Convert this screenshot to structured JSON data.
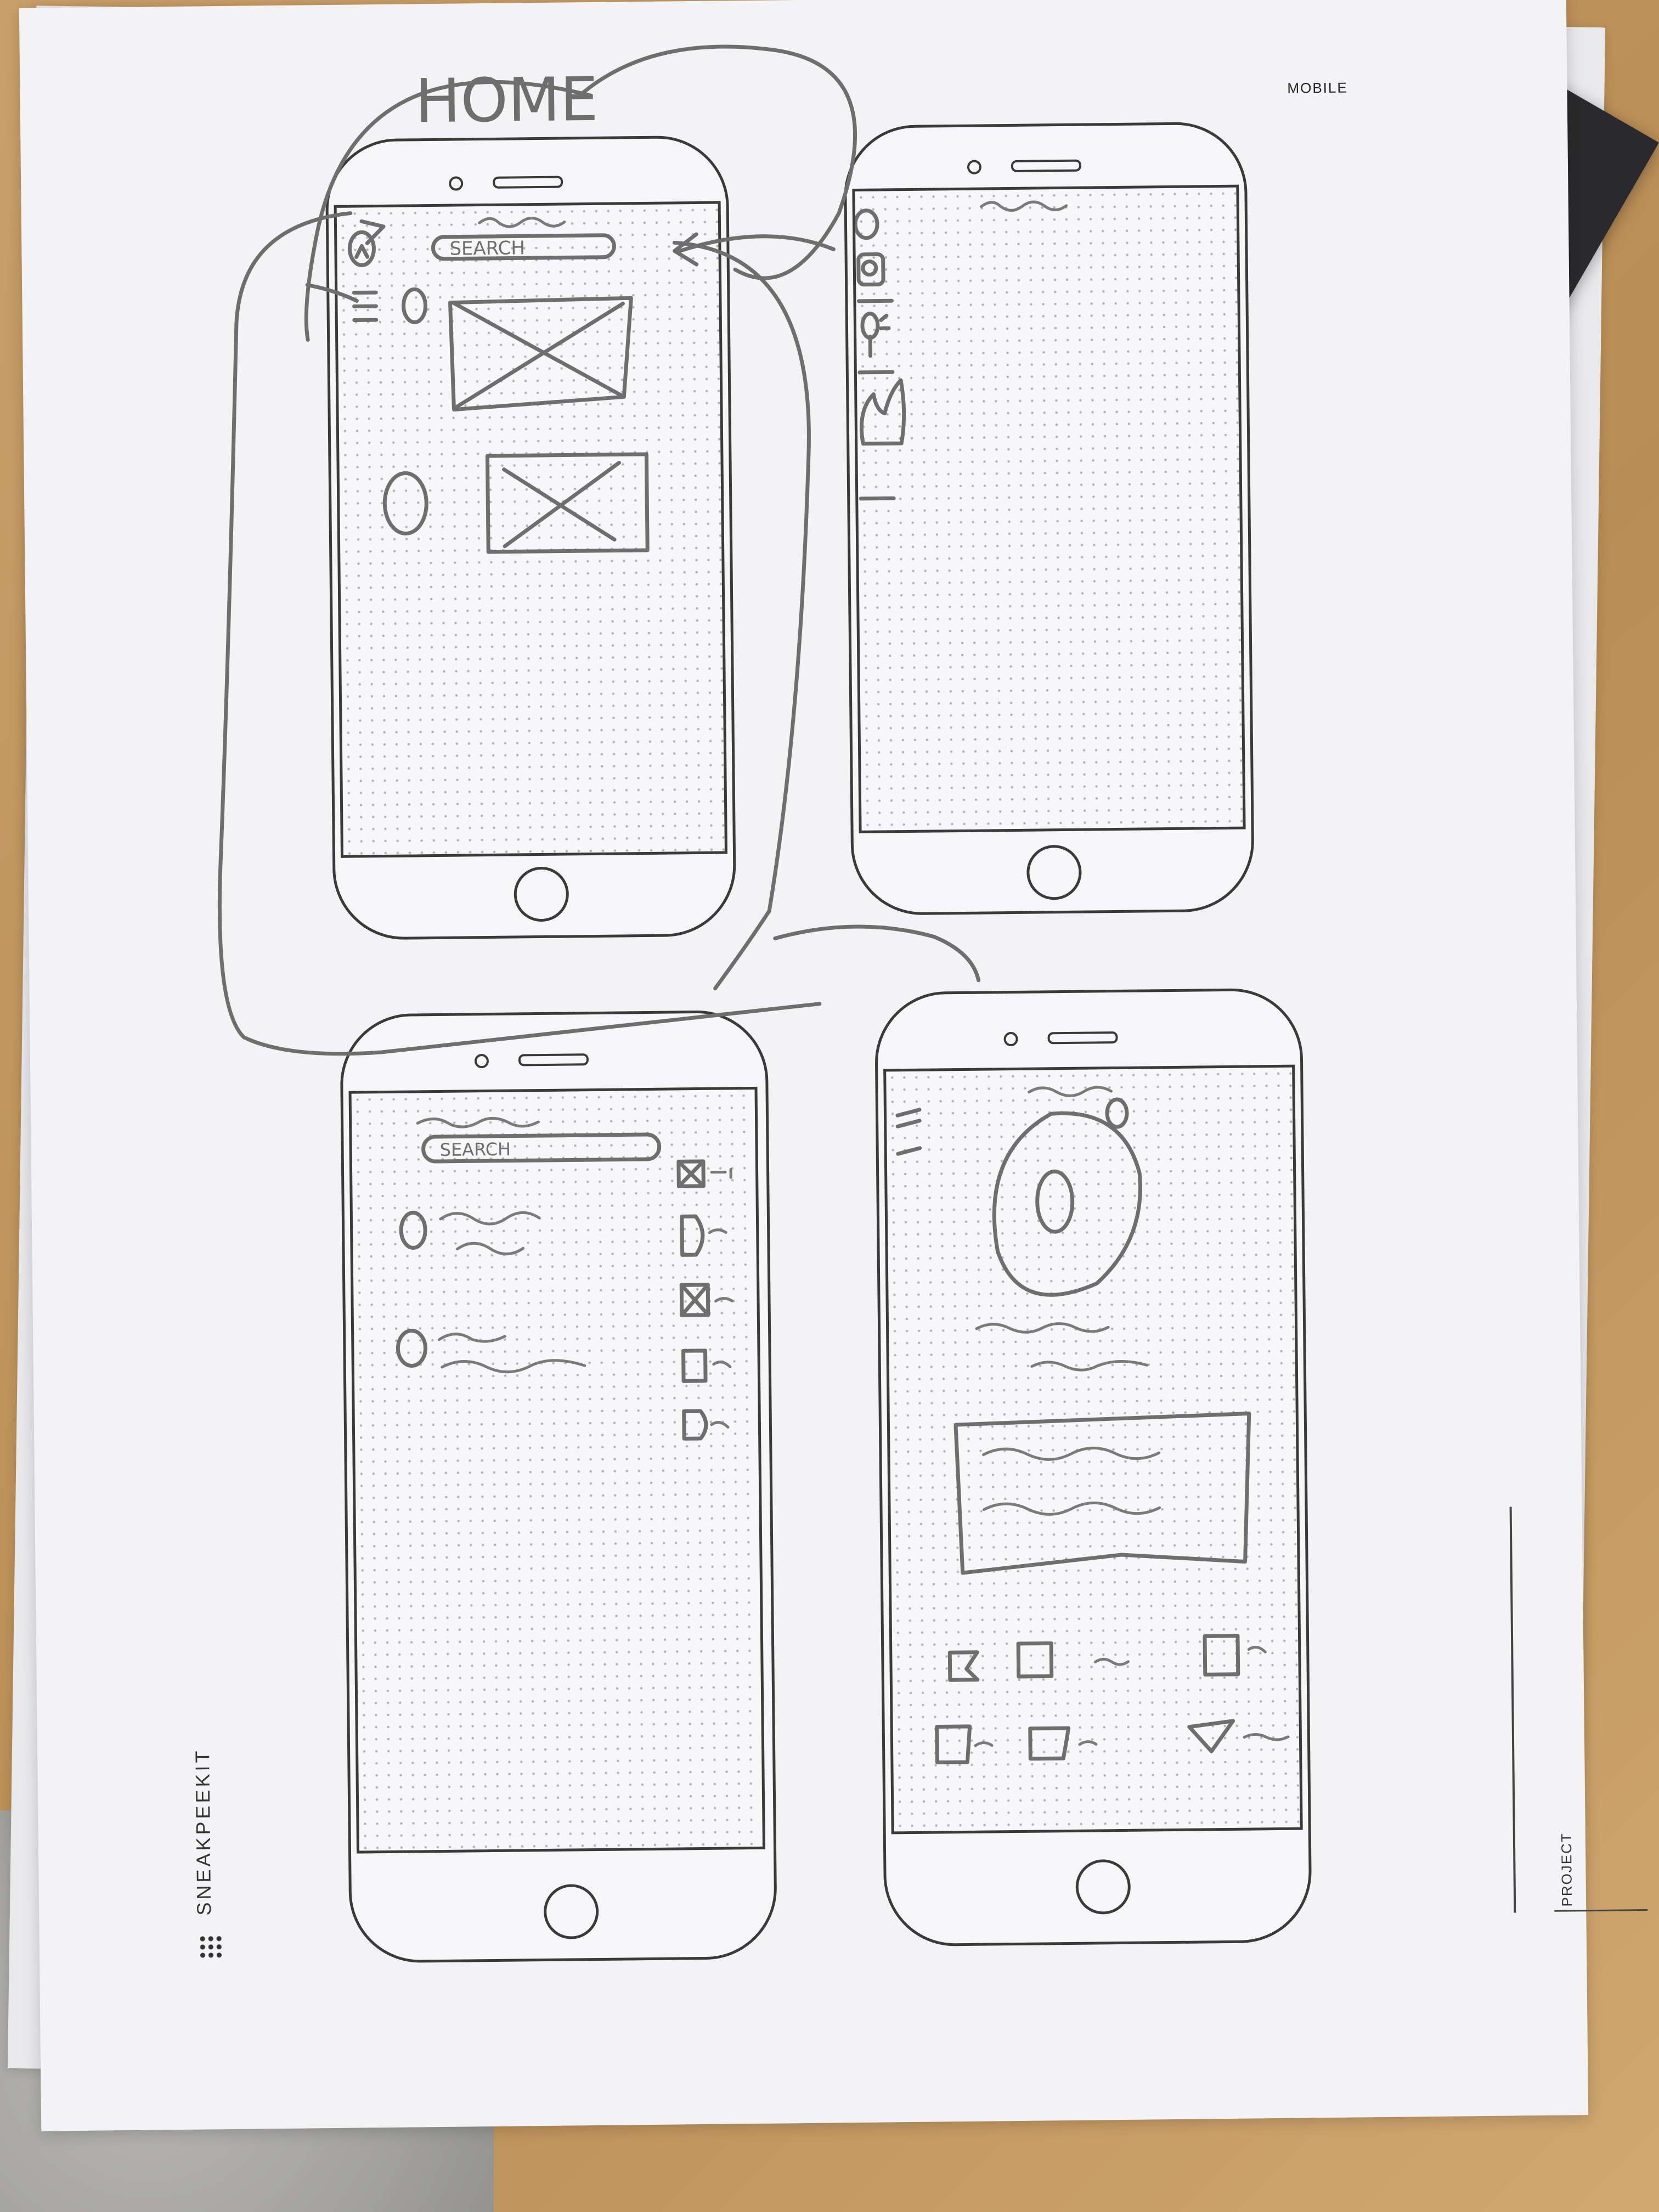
{
  "sheet": {
    "brand": "SNEAKPEEKIT",
    "category_label": "MOBILE",
    "project_label": "PROJECT"
  },
  "sketches": {
    "home_title": "HOME",
    "search_label_top": "SEARCH",
    "search_label_bottom": "SEARCH"
  },
  "icons": [
    "grid-dots-icon",
    "hamburger-icon",
    "search-icon",
    "bulb-icon",
    "flame-icon",
    "checkbox-icon"
  ]
}
